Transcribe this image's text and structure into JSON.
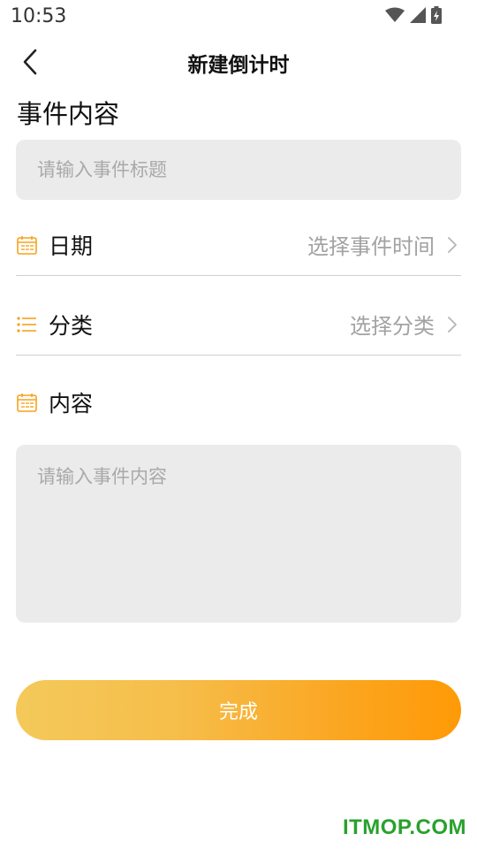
{
  "status_bar": {
    "time": "10:53",
    "icons": [
      "wifi-icon",
      "cellular-signal-icon",
      "battery-charging-icon"
    ]
  },
  "header": {
    "title": "新建倒计时",
    "back_icon": "chevron-left-icon"
  },
  "event": {
    "section_title": "事件内容",
    "title_placeholder": "请输入事件标题"
  },
  "rows": {
    "date": {
      "label": "日期",
      "value": "选择事件时间",
      "icon": "calendar-icon"
    },
    "category": {
      "label": "分类",
      "value": "选择分类",
      "icon": "list-icon"
    },
    "content": {
      "label": "内容",
      "icon": "calendar-icon"
    }
  },
  "content": {
    "placeholder": "请输入事件内容"
  },
  "actions": {
    "done_label": "完成"
  },
  "watermark": "ITMOP.COM",
  "colors": {
    "accent": "#f7a21b",
    "input_bg": "#ebebeb",
    "placeholder": "#a9a9a9",
    "gradient_start": "#f4c95a",
    "gradient_end": "#ff9a06",
    "watermark": "#29a12c"
  }
}
